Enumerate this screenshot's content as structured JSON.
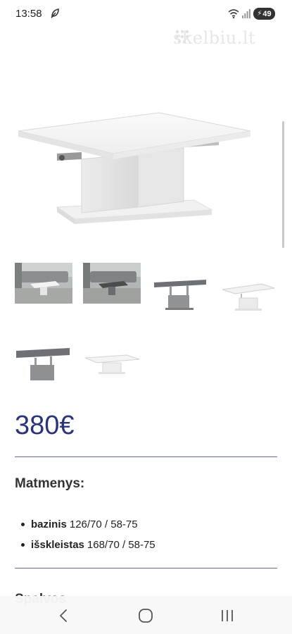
{
  "status_bar": {
    "time": "13:58",
    "battery": "49",
    "icons": [
      "leaf-icon",
      "wifi-icon",
      "signal-icon",
      "battery-icon"
    ]
  },
  "main_image": {
    "watermark": "skelbiu.lt",
    "subject": "white-coffee-table"
  },
  "thumbnails": [
    {
      "name": "thumbnail-white-table-living-room"
    },
    {
      "name": "thumbnail-grey-table-living-room"
    },
    {
      "name": "thumbnail-grey-table-raised"
    },
    {
      "name": "thumbnail-white-table-raised"
    },
    {
      "name": "thumbnail-grey-table-extended"
    },
    {
      "name": "thumbnail-white-table-low"
    }
  ],
  "price": "380€",
  "specs": {
    "title": "Matmenys:",
    "items": [
      {
        "label": "bazinis",
        "value": "126/70 / 58-75"
      },
      {
        "label": "išskleistas",
        "value": "168/70 / 58-75"
      }
    ]
  },
  "next_section_title": "Spalvos",
  "colors": {
    "price": "#2b3478",
    "divider": "#2b3478"
  },
  "nav_bar": {
    "buttons": [
      "back-button",
      "home-button",
      "recents-button"
    ]
  }
}
